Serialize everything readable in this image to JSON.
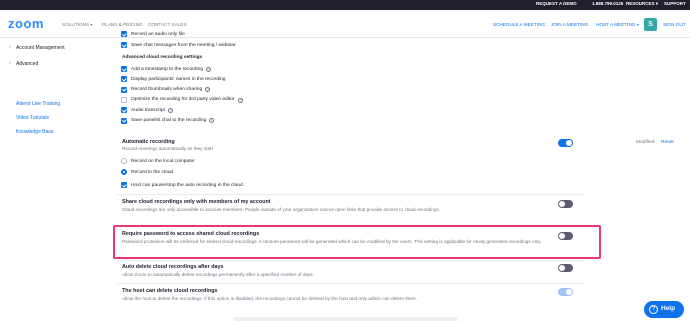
{
  "topbar": {
    "request_demo": "REQUEST A DEMO",
    "phone": "1.888.799.0125",
    "resources": "RESOURCES",
    "support": "SUPPORT"
  },
  "nav": {
    "logo": "zoom",
    "solutions": "SOLUTIONS",
    "plans": "PLANS & PRICING",
    "contact": "CONTACT SALES",
    "schedule": "SCHEDULE A MEETING",
    "join": "JOIN A MEETING",
    "host": "HOST A MEETING",
    "avatar_initial": "S",
    "sign_out": "SIGN OUT"
  },
  "sidebar": {
    "account_management": "Account Management",
    "advanced": "Advanced",
    "links": [
      "Attend Live Training",
      "Video Tutorials",
      "Knowledge Base"
    ]
  },
  "recording": {
    "cut_top_item": "Record an audio only file",
    "save_chat": "Save chat messages from the meeting / webinar",
    "advanced_heading": "Advanced cloud recording settings",
    "advanced_items": [
      {
        "label": "Add a timestamp to the recording",
        "checked": true,
        "info": true
      },
      {
        "label": "Display participants' names in the recording",
        "checked": true,
        "info": false
      },
      {
        "label": "Record thumbnails when sharing",
        "checked": true,
        "info": true
      },
      {
        "label": "Optimize the recording for 3rd party video editor",
        "checked": false,
        "info": true
      },
      {
        "label": "Audio transcript",
        "checked": true,
        "info": true
      },
      {
        "label": "Save panelist chat to the recording",
        "checked": true,
        "info": true
      }
    ]
  },
  "automatic": {
    "title": "Automatic recording",
    "desc": "Record meetings automatically as they start",
    "modified": "Modified",
    "reset": "Reset",
    "options": [
      "Record on the local computer",
      "Record in the cloud"
    ],
    "selected_option": 1,
    "host_pause": "Host can pause/stop the auto recording in the cloud",
    "enabled": true
  },
  "settings": [
    {
      "title": "Share cloud recordings only with members of my account",
      "desc": "Cloud recordings are only accessible to account members. People outside of your organization cannot open links that provide access to cloud recordings.",
      "state": "off"
    },
    {
      "title": "Require password to access shared cloud recordings",
      "desc": "Password protection will be enforced for shared cloud recordings. A random password will be generated which can be modified by the users. This setting is applicable for newly generated recordings only.",
      "state": "off"
    },
    {
      "title": "Auto delete cloud recordings after days",
      "desc": "Allow Zoom to automatically delete recordings permanently after a specified number of days",
      "state": "off"
    },
    {
      "title": "The host can delete cloud recordings",
      "desc": "Allow the host to delete the recordings. If this option is disabled, the recordings cannot be deleted by the host and only admin can delete them.",
      "state": "on-disabled"
    }
  ],
  "help": {
    "label": "Help",
    "icon": "?"
  }
}
